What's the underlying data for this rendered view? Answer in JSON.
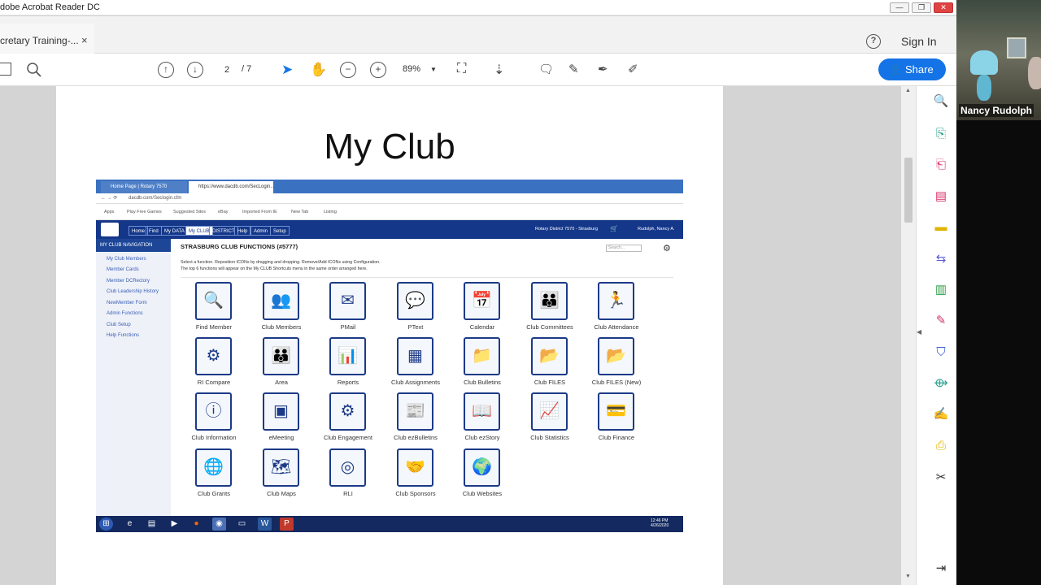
{
  "app": {
    "title": "dobe Acrobat Reader DC",
    "window_controls": [
      "minimize",
      "restore",
      "close"
    ]
  },
  "tab": {
    "label": "cretary Training-...",
    "close": "×"
  },
  "header": {
    "help": "?",
    "signin": "Sign In"
  },
  "toolbar": {
    "page_current": "2",
    "page_total": "/ 7",
    "zoom": "89%",
    "share_label": "Share"
  },
  "slide": {
    "title": "My Club",
    "browser": {
      "tabs": [
        "Home Page | Rotary 7570",
        "https://www.dacdb.com/SecLogin..."
      ],
      "url": "dacdb.com/Seclogin.cfm",
      "bookmarks": [
        "Apps",
        "Play Free Games",
        "Suggested Sites",
        "eBay",
        "Imported From IE",
        "New Tab",
        "Listing"
      ]
    },
    "dac_nav": {
      "items": [
        "Home",
        "Find",
        "My DATA",
        "My CLUB",
        "DISTRICT",
        "Help",
        "Admin",
        "Setup"
      ],
      "district_text": "Rotary District 7570 - Strasburg",
      "user": "Rudolph, Nancy A."
    },
    "sidebar": {
      "heading": "MY CLUB NAVIGATION",
      "items": [
        "My Club Members",
        "Member Cards",
        "Member DCRectory",
        "Club Leadership History",
        "NewMember Form",
        "Admin Functions",
        "Club Setup",
        "Help Functions"
      ]
    },
    "content": {
      "title": "STRASBURG CLUB FUNCTIONS (#5777)",
      "desc_line1": "Select a function. Reposition ICONs by dragging and dropping. Remove/Add ICONs using Configuration.",
      "desc_line2": "The top 6 functions will appear on the My CLUB Shortcuts menu in the same order arranged here.",
      "search_placeholder": "Search..."
    },
    "tiles": [
      {
        "label": "Find Member",
        "glyph": "🔍"
      },
      {
        "label": "Club Members",
        "glyph": "👥"
      },
      {
        "label": "PMail",
        "glyph": "✉"
      },
      {
        "label": "PText",
        "glyph": "💬"
      },
      {
        "label": "Calendar",
        "glyph": "📅"
      },
      {
        "label": "Club Committees",
        "glyph": "👪"
      },
      {
        "label": "Club Attendance",
        "glyph": "🏃"
      },
      {
        "label": "RI Compare",
        "glyph": "⚙"
      },
      {
        "label": "Area",
        "glyph": "👪"
      },
      {
        "label": "Reports",
        "glyph": "📊"
      },
      {
        "label": "Club Assignments",
        "glyph": "▦"
      },
      {
        "label": "Club Bulletins",
        "glyph": "📁"
      },
      {
        "label": "Club FILES",
        "glyph": "📂"
      },
      {
        "label": "Club FILES (New)",
        "glyph": "📂"
      },
      {
        "label": "Club Information",
        "glyph": "ⓘ"
      },
      {
        "label": "eMeeting",
        "glyph": "▣"
      },
      {
        "label": "Club Engagement",
        "glyph": "⚙"
      },
      {
        "label": "Club ezBulletins",
        "glyph": "📰"
      },
      {
        "label": "Club ezStory",
        "glyph": "📖"
      },
      {
        "label": "Club Statistics",
        "glyph": "📈"
      },
      {
        "label": "Club Finance",
        "glyph": "💳"
      },
      {
        "label": "Club Grants",
        "glyph": "🌐"
      },
      {
        "label": "Club Maps",
        "glyph": "🗺"
      },
      {
        "label": "RLI",
        "glyph": "◎"
      },
      {
        "label": "Club Sponsors",
        "glyph": "🤝"
      },
      {
        "label": "Club Websites",
        "glyph": "🌍"
      }
    ],
    "taskbar_time": "12:46 PM",
    "taskbar_date": "4/26/2020"
  },
  "video": {
    "name": "Nancy Rudolph"
  },
  "colors": {
    "accent": "#1473e6",
    "dac_blue": "#14378a",
    "icon_border": "#1c3a87"
  }
}
